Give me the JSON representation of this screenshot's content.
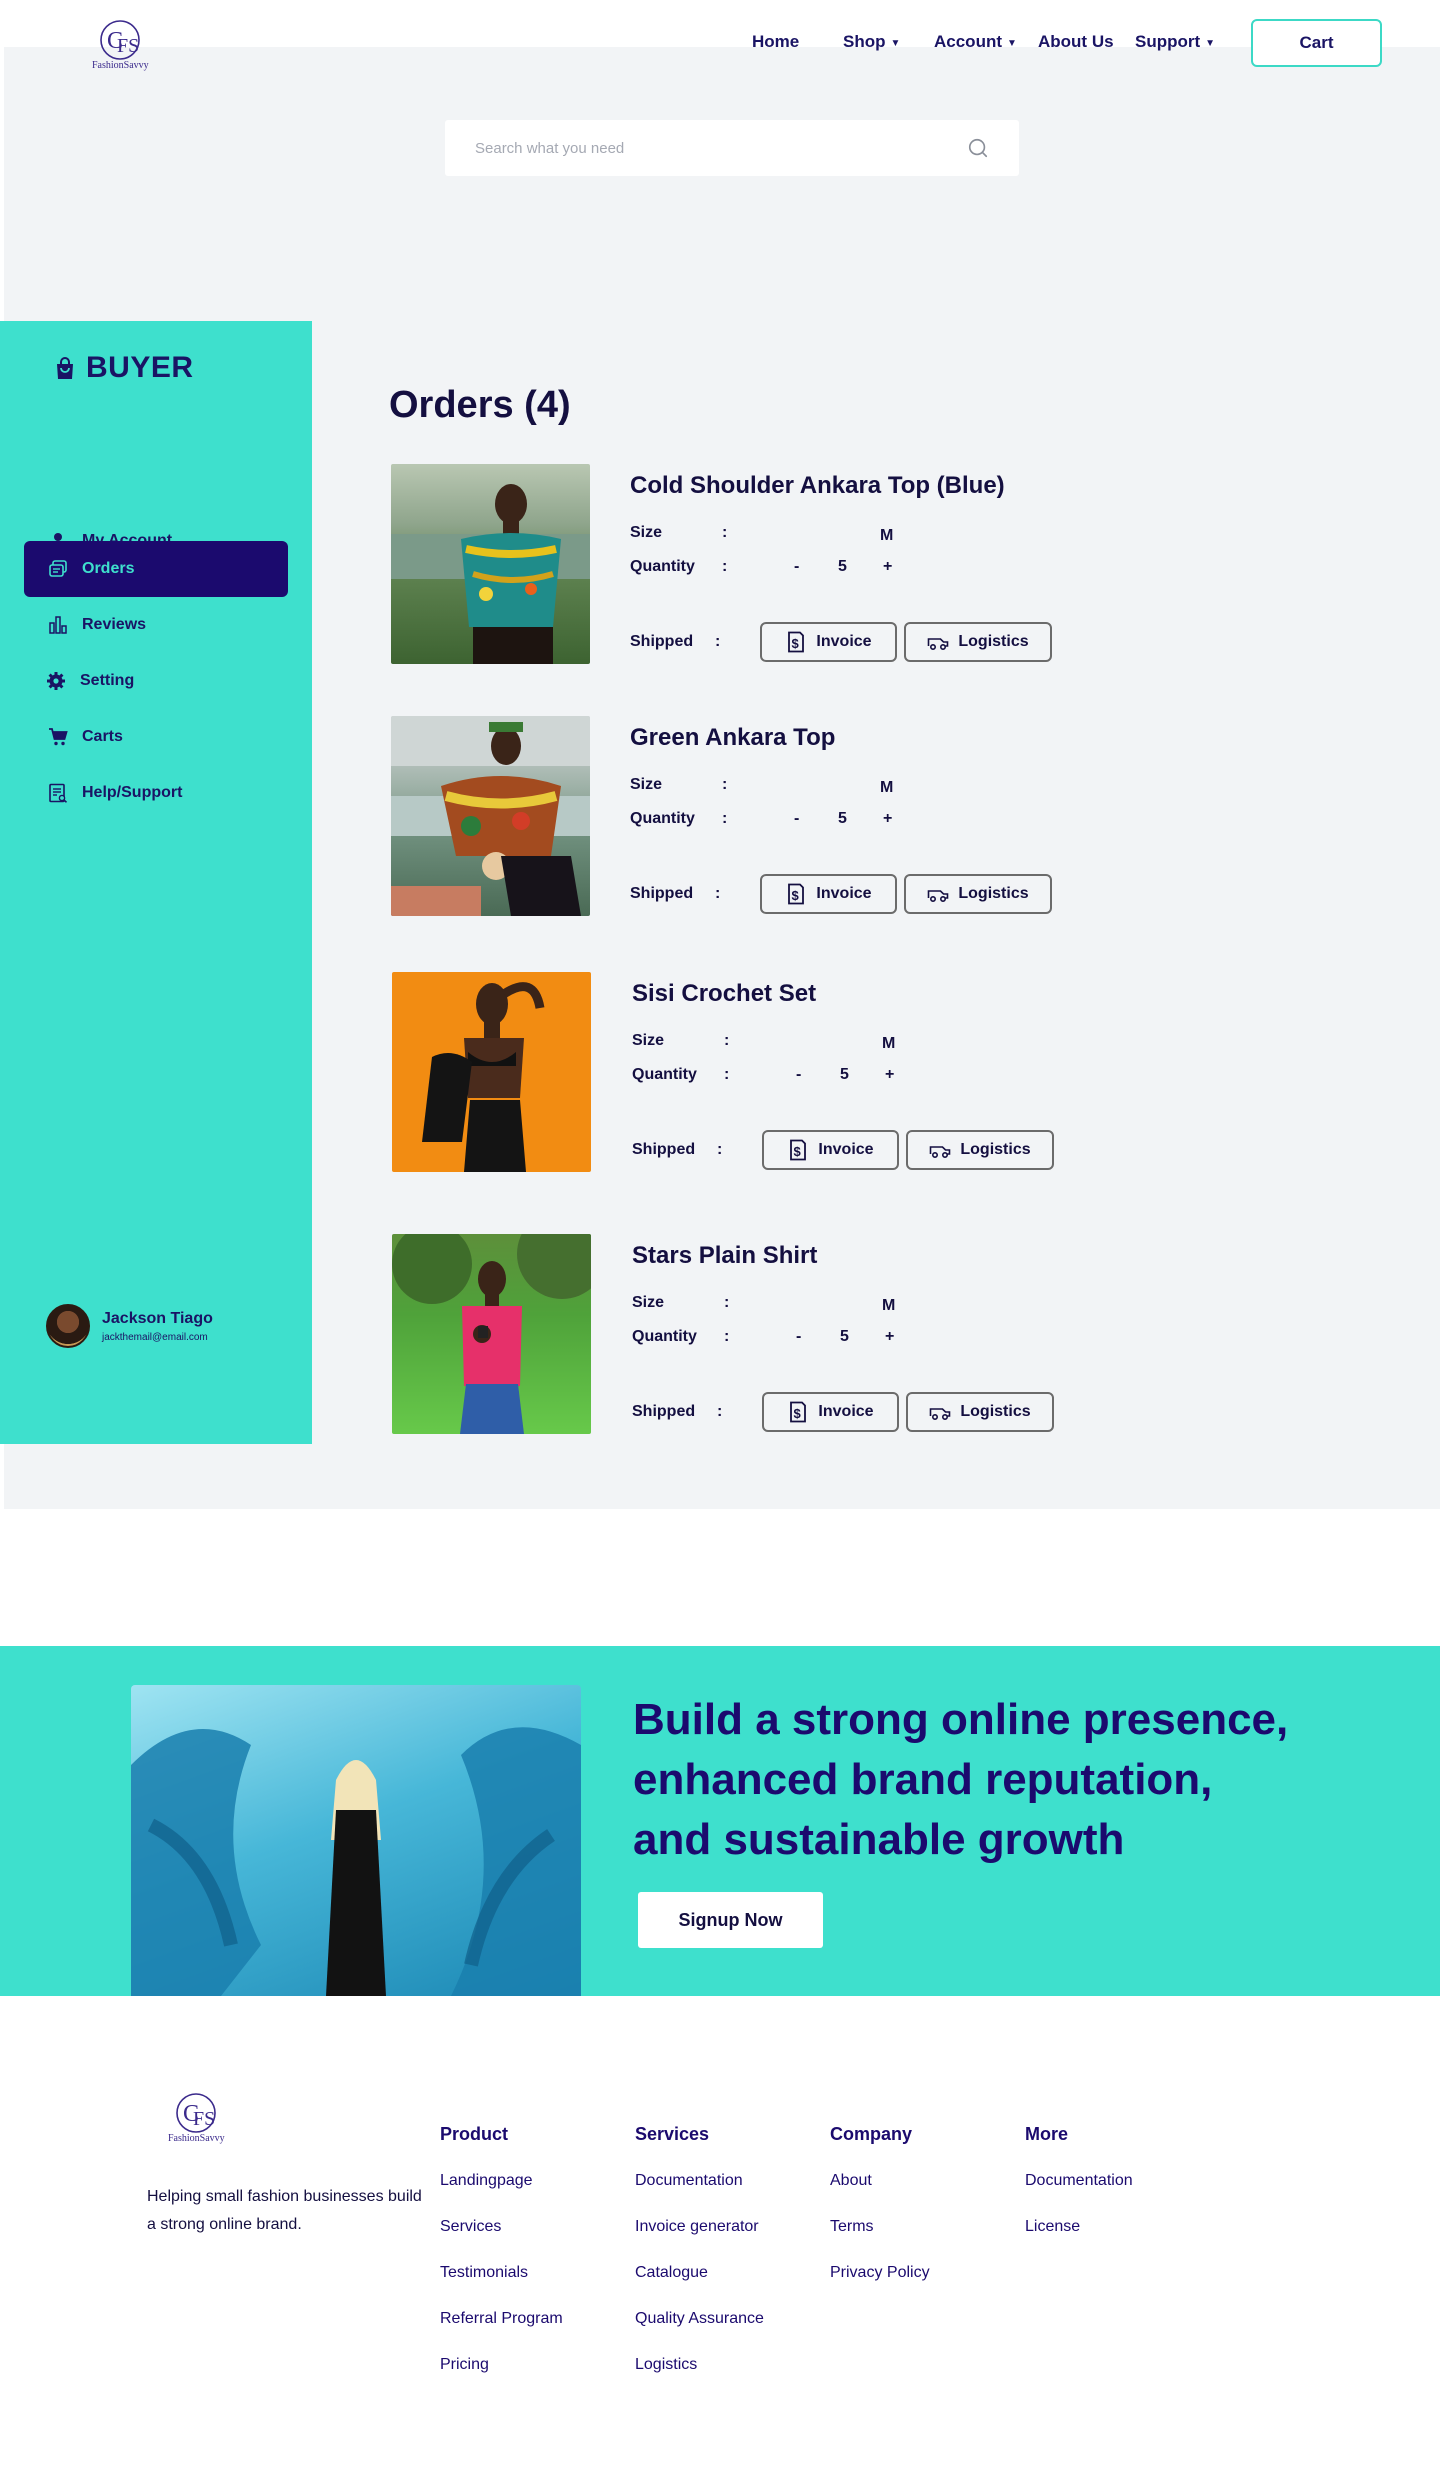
{
  "brand": {
    "logo_text": "FashionSavvy"
  },
  "nav": {
    "home": "Home",
    "shop": "Shop",
    "account": "Account",
    "about": "About Us",
    "support": "Support",
    "cart": "Cart"
  },
  "search": {
    "placeholder": "Search what you need"
  },
  "sidebar": {
    "role": "BUYER",
    "items": [
      {
        "label": "My Account",
        "icon": "user-icon"
      },
      {
        "label": "Orders",
        "icon": "orders-icon",
        "active": true
      },
      {
        "label": "Reviews",
        "icon": "bar-chart-icon"
      },
      {
        "label": "Setting",
        "icon": "gear-icon"
      },
      {
        "label": "Carts",
        "icon": "cart-icon"
      },
      {
        "label": "Help/Support",
        "icon": "help-doc-icon"
      }
    ],
    "profile": {
      "name": "Jackson Tiago",
      "email": "jackthemail@email.com"
    }
  },
  "orders": {
    "title": "Orders (4)",
    "size_label": "Size",
    "quantity_label": "Quantity",
    "colon": ":",
    "minus": "-",
    "plus": "+",
    "invoice_label": "Invoice",
    "logistics_label": "Logistics",
    "items": [
      {
        "name": "Cold Shoulder Ankara Top (Blue)",
        "size": "M",
        "quantity": "5",
        "status": "Shipped"
      },
      {
        "name": "Green Ankara Top",
        "size": "M",
        "quantity": "5",
        "status": "Shipped"
      },
      {
        "name": "Sisi Crochet Set",
        "size": "M",
        "quantity": "5",
        "status": "Shipped"
      },
      {
        "name": "Stars  Plain Shirt",
        "size": "M",
        "quantity": "5",
        "status": "Shipped"
      }
    ]
  },
  "banner": {
    "line1": "Build a strong online presence,",
    "line2": "enhanced brand reputation,",
    "line3": "and sustainable growth",
    "cta": "Signup Now"
  },
  "footer": {
    "tagline": "Helping small fashion businesses build a strong online brand.",
    "columns": [
      {
        "title": "Product",
        "links": [
          "Landingpage",
          "Services",
          "Testimonials",
          "Referral Program",
          "Pricing"
        ]
      },
      {
        "title": "Services",
        "links": [
          "Documentation",
          "Invoice generator",
          "Catalogue",
          "Quality Assurance",
          "Logistics"
        ]
      },
      {
        "title": "Company",
        "links": [
          "About",
          "Terms",
          "Privacy Policy"
        ]
      },
      {
        "title": "More",
        "links": [
          "Documentation",
          "License"
        ]
      }
    ]
  },
  "colors": {
    "accent": "#3ee0cd",
    "navy": "#1b0a6e",
    "background": "#f2f4f6"
  }
}
